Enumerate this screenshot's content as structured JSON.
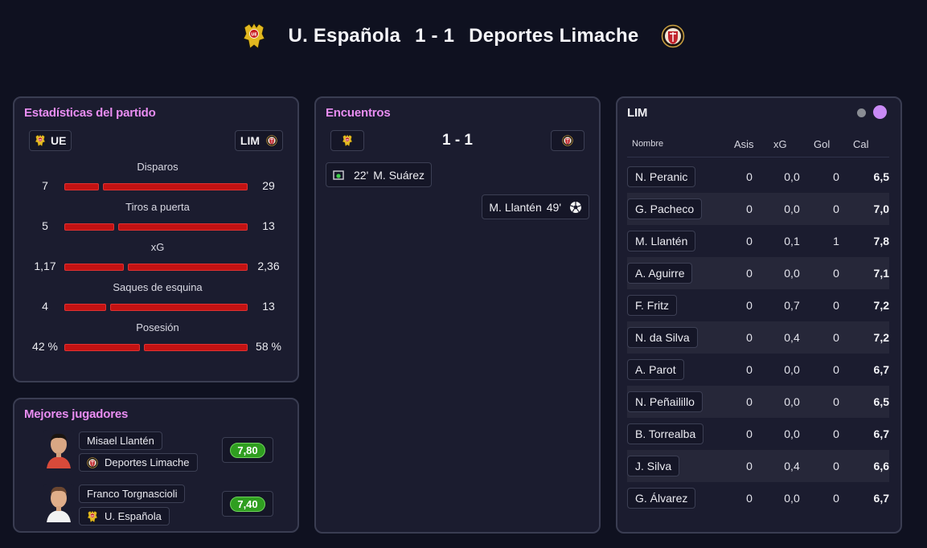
{
  "match": {
    "home_team": "U. Española",
    "away_team": "Deportes Limache",
    "score": "1 - 1",
    "home_short": "UE",
    "away_short": "LIM"
  },
  "colors": {
    "accent_pink": "#e98df2",
    "bar_red": "#c31212",
    "rating_green": "#2f9e20",
    "background": "#0f1120",
    "card": "#1b1c2f"
  },
  "stats": {
    "title": "Estadísticas del partido",
    "rows": [
      {
        "label": "Disparos",
        "home": "7",
        "away": "29",
        "home_share": 0.194
      },
      {
        "label": "Tiros a puerta",
        "home": "5",
        "away": "13",
        "home_share": 0.278
      },
      {
        "label": "xG",
        "home": "1,17",
        "away": "2,36",
        "home_share": 0.331
      },
      {
        "label": "Saques de esquina",
        "home": "4",
        "away": "13",
        "home_share": 0.235
      },
      {
        "label": "Posesión",
        "home": "42 %",
        "away": "58 %",
        "home_share": 0.42
      }
    ]
  },
  "best_players": {
    "title": "Mejores jugadores",
    "players": [
      {
        "name": "Misael Llantén",
        "team": "Deportes Limache",
        "rating": "7,80"
      },
      {
        "name": "Franco Torgnascioli",
        "team": "U. Española",
        "rating": "7,40"
      }
    ]
  },
  "encounters": {
    "title": "Encuentros",
    "score": "1 - 1",
    "events": [
      {
        "minute": "22'",
        "player": "M. Suárez",
        "icon": "own-goal-icon",
        "side": "home"
      },
      {
        "minute": "49'",
        "player": "M. Llantén",
        "icon": "ball-icon",
        "side": "away"
      }
    ]
  },
  "lineup": {
    "team": "LIM",
    "headers": {
      "name": "Nombre",
      "assists": "Asis",
      "xg": "xG",
      "goals": "Gol",
      "rating": "Cal"
    },
    "players": [
      {
        "name": "N. Peranic",
        "assists": "0",
        "xg": "0,0",
        "goals": "0",
        "rating": "6,5"
      },
      {
        "name": "G. Pacheco",
        "assists": "0",
        "xg": "0,0",
        "goals": "0",
        "rating": "7,0"
      },
      {
        "name": "M. Llantén",
        "assists": "0",
        "xg": "0,1",
        "goals": "1",
        "rating": "7,8"
      },
      {
        "name": "A. Aguirre",
        "assists": "0",
        "xg": "0,0",
        "goals": "0",
        "rating": "7,1"
      },
      {
        "name": "F. Fritz",
        "assists": "0",
        "xg": "0,7",
        "goals": "0",
        "rating": "7,2"
      },
      {
        "name": "N. da Silva",
        "assists": "0",
        "xg": "0,4",
        "goals": "0",
        "rating": "7,2"
      },
      {
        "name": "A. Parot",
        "assists": "0",
        "xg": "0,0",
        "goals": "0",
        "rating": "6,7"
      },
      {
        "name": "N. Peñailillo",
        "assists": "0",
        "xg": "0,0",
        "goals": "0",
        "rating": "6,5"
      },
      {
        "name": "B. Torrealba",
        "assists": "0",
        "xg": "0,0",
        "goals": "0",
        "rating": "6,7"
      },
      {
        "name": "J. Silva",
        "assists": "0",
        "xg": "0,4",
        "goals": "0",
        "rating": "6,6"
      },
      {
        "name": "G. Álvarez",
        "assists": "0",
        "xg": "0,0",
        "goals": "0",
        "rating": "6,7"
      }
    ]
  }
}
